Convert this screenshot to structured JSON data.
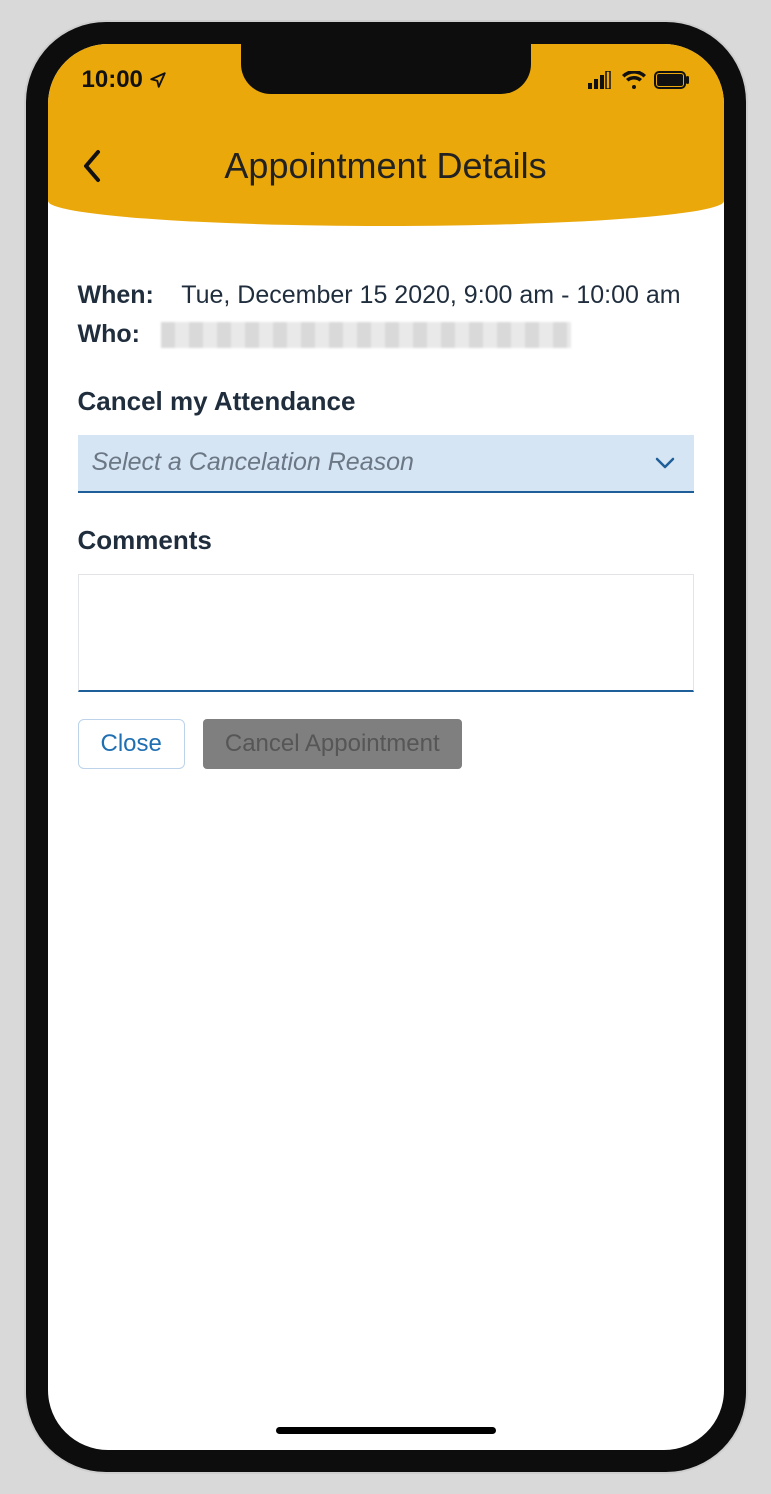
{
  "status": {
    "time": "10:00"
  },
  "header": {
    "title": "Appointment Details"
  },
  "details": {
    "when_label": "When:",
    "when_value": "Tue, December 15 2020, 9:00 am - 10:00 am",
    "who_label": "Who:"
  },
  "cancel_section": {
    "title": "Cancel my Attendance",
    "select_placeholder": "Select a Cancelation Reason"
  },
  "comments_section": {
    "title": "Comments"
  },
  "buttons": {
    "close": "Close",
    "cancel_appointment": "Cancel Appointment"
  }
}
